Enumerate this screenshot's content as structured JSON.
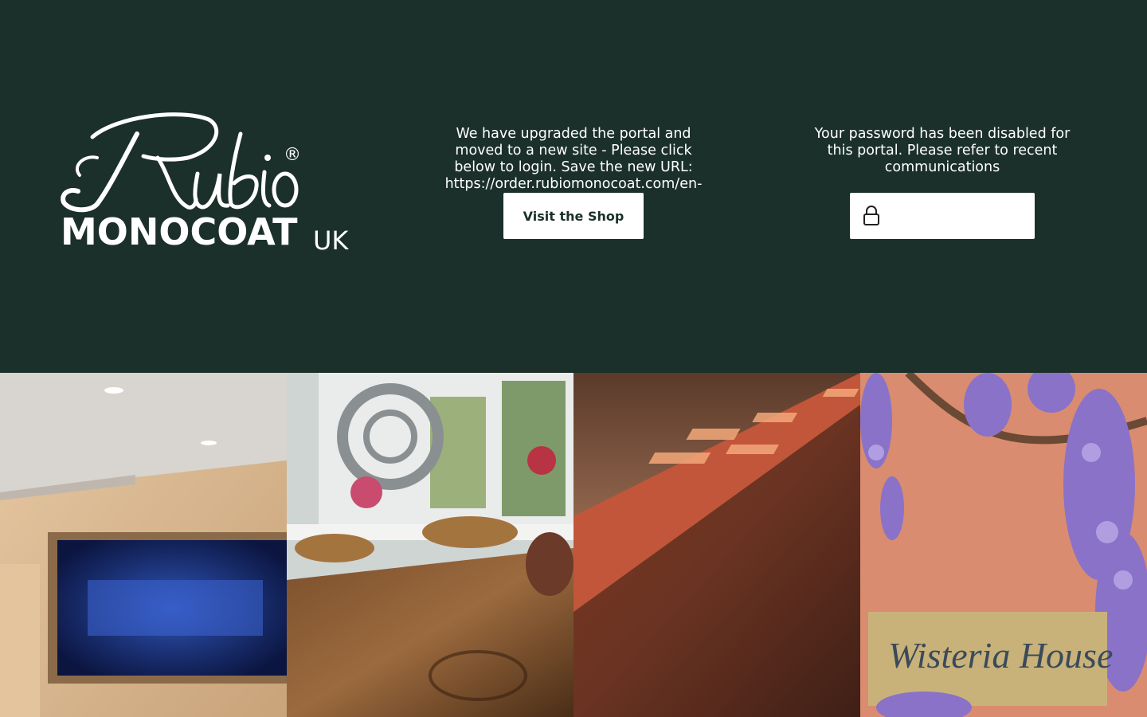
{
  "brand": {
    "script_name": "Rubio",
    "registered_mark": "®",
    "wordmark": "MONOCOAT",
    "country": "UK"
  },
  "upgrade_notice": {
    "message": "We have upgraded the portal and moved to a new site - Please click below to login. Save the new URL: https://order.rubiomonocoat.com/en-",
    "button_label": "Visit the Shop"
  },
  "password_notice": {
    "message": "Your password has been disabled for this portal. Please refer to recent communications",
    "input_value": "",
    "input_placeholder": ""
  },
  "gallery": {
    "tiles": [
      {
        "name": "kitchen-fireplace-photo"
      },
      {
        "name": "dining-table-photo"
      },
      {
        "name": "wood-beam-sunlight-photo"
      },
      {
        "name": "wisteria-house-sign-photo"
      }
    ],
    "sign_text": "Wisteria House"
  },
  "colors": {
    "background": "#1b302a",
    "button_bg": "#ffffff",
    "button_text": "#1b302a"
  }
}
